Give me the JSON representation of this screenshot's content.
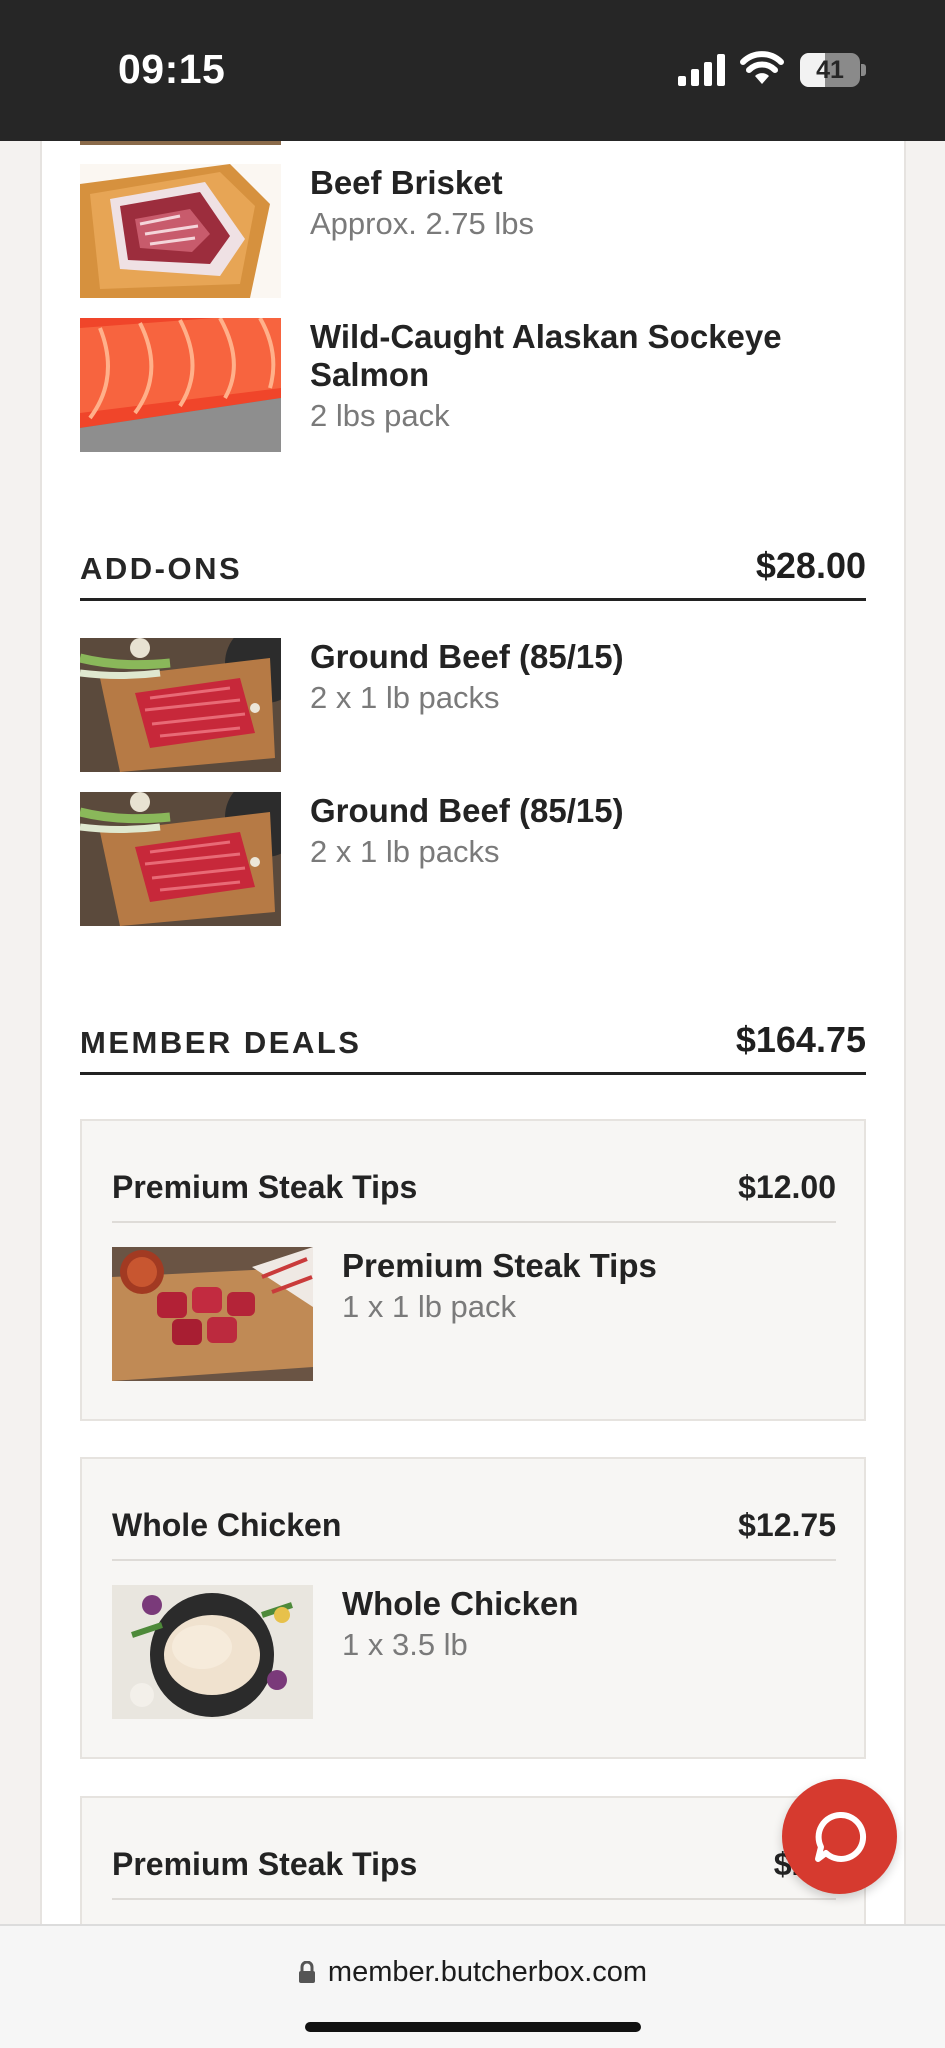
{
  "status_bar": {
    "time": "09:15",
    "battery": "41",
    "battery_level": 0.41
  },
  "box_items": [
    {
      "name": "Beef Brisket",
      "qty": "Approx. 2.75 lbs",
      "image": "beef-brisket-photo"
    },
    {
      "name": "Wild-Caught Alaskan Sockeye Salmon",
      "qty": "2 lbs pack",
      "image": "salmon-photo"
    }
  ],
  "addons": {
    "title": "ADD-ONS",
    "total": "$28.00",
    "items": [
      {
        "name": "Ground Beef (85/15)",
        "qty": "2 x 1 lb packs",
        "image": "ground-beef-photo"
      },
      {
        "name": "Ground Beef (85/15)",
        "qty": "2 x 1 lb packs",
        "image": "ground-beef-photo"
      }
    ]
  },
  "member_deals": {
    "title": "MEMBER DEALS",
    "total": "$164.75",
    "deals": [
      {
        "title": "Premium Steak Tips",
        "price": "$12.00",
        "item_name": "Premium Steak Tips",
        "item_qty": "1 x 1 lb pack",
        "image": "steak-tips-photo"
      },
      {
        "title": "Whole Chicken",
        "price": "$12.75",
        "item_name": "Whole Chicken",
        "item_qty": "1 x 3.5 lb",
        "image": "whole-chicken-photo"
      },
      {
        "title": "Premium Steak Tips",
        "price": "$12."
      }
    ]
  },
  "browser": {
    "url": "member.butcherbox.com"
  },
  "colors": {
    "accent": "#d63a2f",
    "text": "#232323",
    "muted": "#7a7a7a",
    "card": "#f7f6f4"
  },
  "icons": [
    "signal-icon",
    "wifi-icon",
    "battery-icon",
    "lock-icon",
    "chat-icon"
  ]
}
